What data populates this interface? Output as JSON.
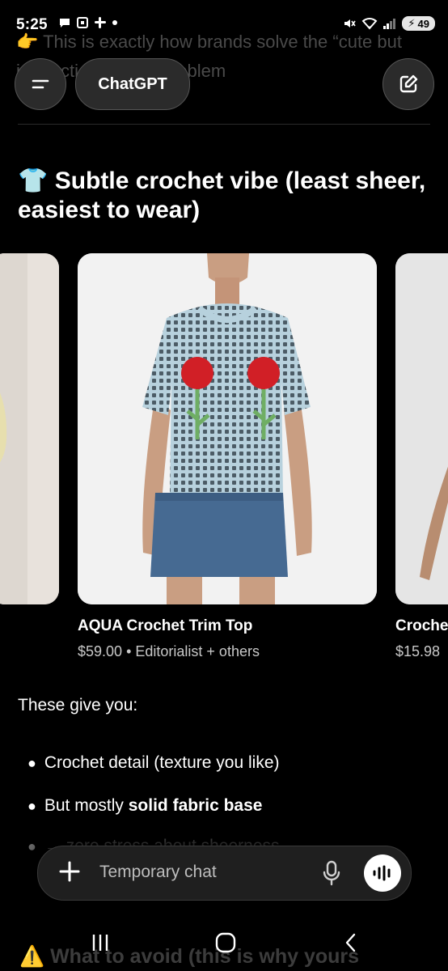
{
  "status_bar": {
    "time": "5:25",
    "battery": "49"
  },
  "background_text": {
    "line": "👉 This is exactly how brands solve the “cute but impractical sheer” problem"
  },
  "header": {
    "title": "ChatGPT"
  },
  "section": {
    "emoji": "👕",
    "heading": "Subtle crochet vibe (least sheer, easiest to wear)"
  },
  "products": {
    "main": {
      "title": "AQUA Crochet Trim Top",
      "price": "$59.00",
      "sellers": "Editorialist + others"
    },
    "right": {
      "title": "Croche",
      "price": "$15.98"
    }
  },
  "body": {
    "intro": "These give you:",
    "bullet1": "Crochet detail (texture you like)",
    "bullet2_prefix": "But mostly ",
    "bullet2_bold": "solid fabric base",
    "bullet3": "→ zero stress about sheerness"
  },
  "composer": {
    "placeholder": "Temporary chat"
  },
  "faded_footer": {
    "text": "⚠️ What to avoid (this is why yours"
  },
  "colors": {
    "background": "#000000",
    "pill": "#2b2b2b",
    "shirt": "#b9d3df",
    "flower": "#d11f26"
  }
}
